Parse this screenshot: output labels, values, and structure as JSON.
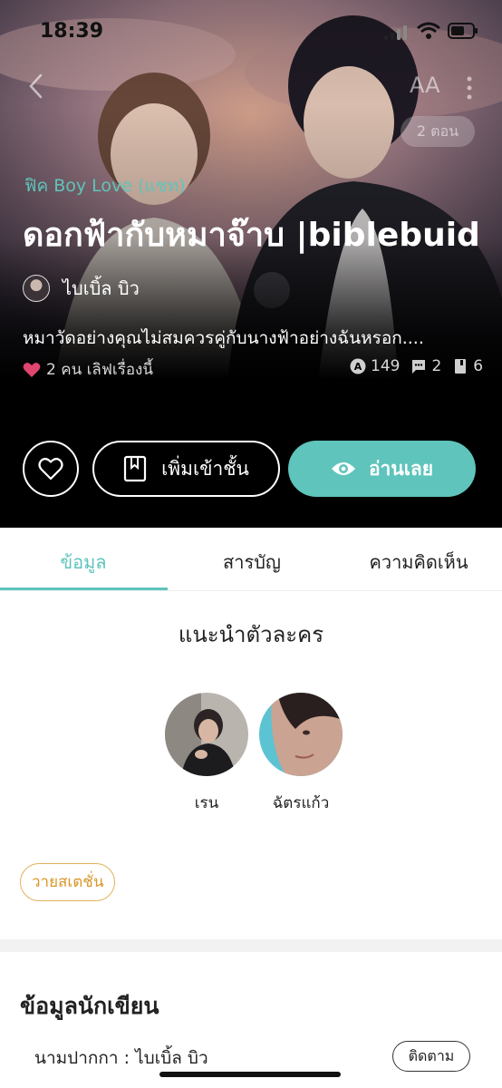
{
  "status": {
    "time": "18:39"
  },
  "header": {
    "font_size_icon": "AA",
    "episode_badge": "2 ตอน"
  },
  "story": {
    "genre": "ฟิค Boy Love (แชท)",
    "title": "ดอกฟ้ากับหมาจ๊าบ |biblebuid",
    "author": "ไบเบิ้ล บิว",
    "synopsis": "หมาวัดอย่างคุณไม่สมควรคู่กับนางฟ้าอย่างฉันหรอก....",
    "favorites": "2 คน เลิฟเรื่องนี้",
    "stats": {
      "views": "149",
      "comments": "2",
      "chapters": "6"
    }
  },
  "actions": {
    "add_shelf": "เพิ่มเข้าชั้น",
    "read_now": "อ่านเลย"
  },
  "tabs": [
    {
      "label": "ข้อมูล"
    },
    {
      "label": "สารบัญ"
    },
    {
      "label": "ความคิดเห็น"
    }
  ],
  "characters": {
    "title": "แนะนำตัวละคร",
    "items": [
      {
        "name": "เรน"
      },
      {
        "name": "ฉัตรแก้ว"
      }
    ]
  },
  "tag": "วายสเตชั่น",
  "writer": {
    "title": "ข้อมูลนักเขียน",
    "penname": "นามปากกา : ไบเบิ้ล บิว",
    "follow": "ติดตาม"
  },
  "colors": {
    "accent": "#5fc4bb",
    "heart": "#e0456f",
    "tag": "#d8962a"
  }
}
